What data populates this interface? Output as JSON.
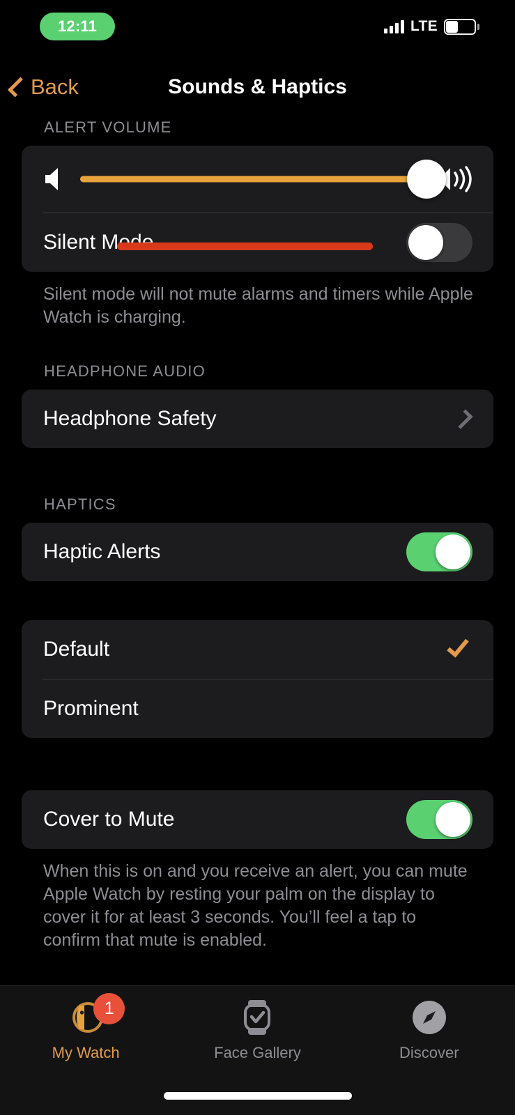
{
  "status_bar": {
    "time": "12:11",
    "carrier_tech": "LTE",
    "time_pill_color": "#5ad071",
    "signal_bars": 4,
    "battery_level_pct": 40
  },
  "nav": {
    "back_label": "Back",
    "title": "Sounds & Haptics",
    "accent_color": "#e39b4b"
  },
  "sections": {
    "alert_volume": {
      "header": "ALERT VOLUME",
      "slider": {
        "value_pct": 100,
        "fill_color": "#e8a33d",
        "low_icon": "speaker-low-icon",
        "high_icon": "speaker-high-icon"
      },
      "annotation_bar_color": "#d8391b",
      "silent_mode": {
        "label": "Silent Mode",
        "enabled": false
      },
      "footnote": "Silent mode will not mute alarms and timers while Apple Watch is charging."
    },
    "headphone_audio": {
      "header": "HEADPHONE AUDIO",
      "rows": [
        {
          "label": "Headphone Safety",
          "accessory": "chevron-right-icon"
        }
      ]
    },
    "haptics": {
      "header": "HAPTICS",
      "haptic_alerts": {
        "label": "Haptic Alerts",
        "enabled": true
      },
      "options": [
        {
          "label": "Default",
          "selected": true
        },
        {
          "label": "Prominent",
          "selected": false
        }
      ],
      "check_color": "#e39b4b"
    },
    "cover_to_mute": {
      "label": "Cover to Mute",
      "enabled": true,
      "footnote": "When this is on and you receive an alert, you can mute Apple Watch by resting your palm on the display to cover it for at least 3 seconds. You’ll feel a tap to confirm that mute is enabled."
    }
  },
  "tabbar": {
    "items": [
      {
        "label": "My Watch",
        "icon": "watch-icon",
        "active": true,
        "badge": "1"
      },
      {
        "label": "Face Gallery",
        "icon": "watch-face-check-icon",
        "active": false
      },
      {
        "label": "Discover",
        "icon": "compass-icon",
        "active": false
      }
    ],
    "badge_color": "#e8503a",
    "active_color": "#e39b4b"
  }
}
